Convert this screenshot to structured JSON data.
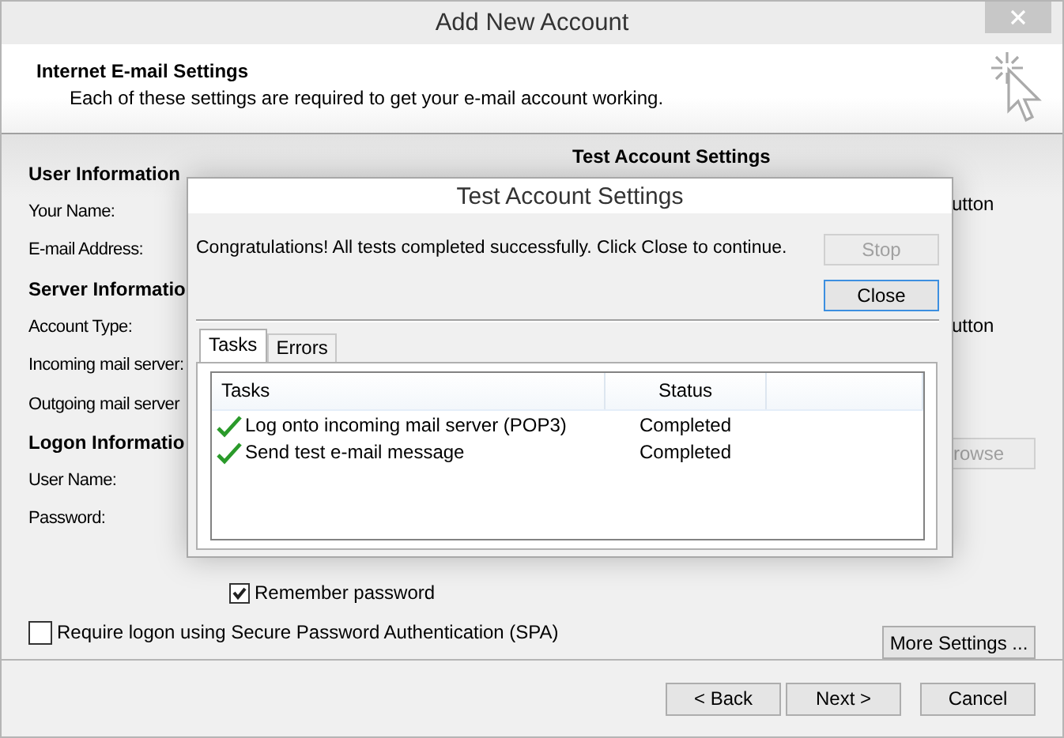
{
  "window": {
    "title": "Add New Account"
  },
  "header": {
    "title": "Internet E-mail Settings",
    "subtitle": "Each of these settings are required to get your e-mail account working."
  },
  "sections": [
    {
      "heading": "User Information",
      "labels": [
        "Your Name:",
        "E-mail Address:"
      ]
    },
    {
      "heading": "Server Informatio",
      "labels": [
        "Account Type:",
        "Incoming mail server:",
        "Outgoing mail server"
      ]
    },
    {
      "heading": "Logon Informatio",
      "labels": [
        "User Name:",
        "Password:"
      ]
    }
  ],
  "test_settings": {
    "heading": "Test Account Settings",
    "texts": [
      "utton",
      "utton"
    ],
    "browse_button": "rowse"
  },
  "remember_password": {
    "label": "Remember password",
    "checked": true
  },
  "spa": {
    "label": "Require logon using Secure Password Authentication (SPA)",
    "checked": false
  },
  "more_settings_button": "More Settings ...",
  "footer_buttons": [
    "< Back",
    "Next >",
    "Cancel"
  ],
  "dialog": {
    "title": "Test Account Settings",
    "message": "Congratulations! All tests completed successfully. Click Close to continue.",
    "buttons": [
      {
        "label": "Stop",
        "disabled": true,
        "default": false
      },
      {
        "label": "Close",
        "disabled": false,
        "default": true
      }
    ],
    "tabs": [
      {
        "label": "Tasks",
        "selected": true
      },
      {
        "label": "Errors",
        "selected": false
      }
    ],
    "table": {
      "columns": [
        "Tasks",
        "Status"
      ],
      "rows": [
        {
          "task": "Log onto incoming mail server (POP3)",
          "status": "Completed",
          "done": true
        },
        {
          "task": "Send test e-mail message",
          "status": "Completed",
          "done": true
        }
      ]
    }
  }
}
